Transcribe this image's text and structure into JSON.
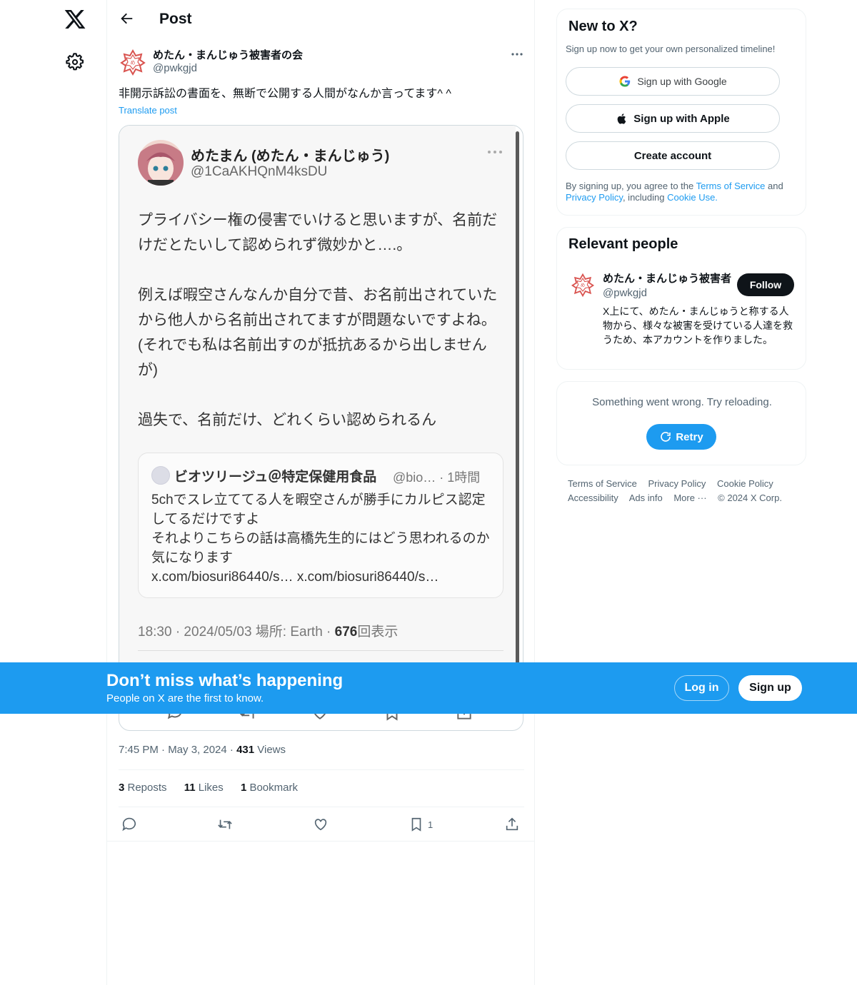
{
  "header": {
    "title": "Post"
  },
  "post": {
    "author_name": "めたん・まんじゅう被害者の会",
    "author_handle": "@pwkgjd",
    "text": "非開示訴訟の書面を、無断で公開する人間がなんか言ってます^ ^",
    "translate_label": "Translate post",
    "timestamp": "7:45 PM · May 3, 2024 · ",
    "views_count": "431",
    "views_label": " Views",
    "reposts_count": "3",
    "reposts_label": " Reposts",
    "likes_count": "11",
    "likes_label": " Likes",
    "bookmarks_count": "1",
    "bookmarks_label": " Bookmark",
    "bookmark_action_count": "1"
  },
  "embedded_screenshot": {
    "name": "めたまん (めたん・まんじゅう)",
    "handle": "@1CaAKHQnM4ksDU",
    "body": "プライバシー権の侵害でいけると思いますが、名前だけだとたいして認められず微妙かと….。\n\n例えば暇空さんなんか自分で昔、お名前出されていたから他人から名前出されてますが問題ないですよね。(それでも私は名前出すのが抵抗あるから出しませんが)\n\n過失で、名前だけ、どれくらい認められるん",
    "quote_name": "ビオツリージュ＠特定保健用食品",
    "quote_meta": "@bio… · 1時間",
    "quote_body": "5chでスレ立ててる人を暇空さんが勝手にカルピス認定してるだけですよ\nそれよりこちらの話は高橋先生的にはどう思われるのか気になります\nx.com/biosuri86440/s… x.com/biosuri86440/s…",
    "footer_prefix": "18:30 · 2024/05/03 場所: Earth · ",
    "footer_views": "676",
    "footer_suffix": "回表示"
  },
  "signup_card": {
    "title": "New to X?",
    "subtitle": "Sign up now to get your own personalized timeline!",
    "google_label": "Sign up with Google",
    "apple_label": "Sign up with Apple",
    "create_label": "Create account",
    "terms_prefix": "By signing up, you agree to the ",
    "terms_link": "Terms of Service",
    "terms_and": " and ",
    "privacy_link": "Privacy Policy",
    "terms_including": ", including ",
    "cookie_link": "Cookie Use."
  },
  "relevant_people": {
    "title": "Relevant people",
    "name": "めたん・まんじゅう被害者",
    "handle": "@pwkgjd",
    "follow_label": "Follow",
    "bio": "X上にて、めたん・まんじゅうと称する人物から、様々な被害を受けている人達を救うため、本アカウントを作りました。"
  },
  "error_card": {
    "message": "Something went wrong. Try reloading.",
    "retry_label": "Retry"
  },
  "footer": {
    "links": [
      "Terms of Service",
      "Privacy Policy",
      "Cookie Policy",
      "Accessibility",
      "Ads info",
      "More ···",
      "© 2024 X Corp."
    ]
  },
  "banner": {
    "title": "Don’t miss what’s happening",
    "subtitle": "People on X are the first to know.",
    "login_label": "Log in",
    "signup_label": "Sign up"
  },
  "colors": {
    "accent": "#1d9bf0",
    "text": "#0f1419",
    "muted": "#536471",
    "seal_red": "#d9534f"
  }
}
